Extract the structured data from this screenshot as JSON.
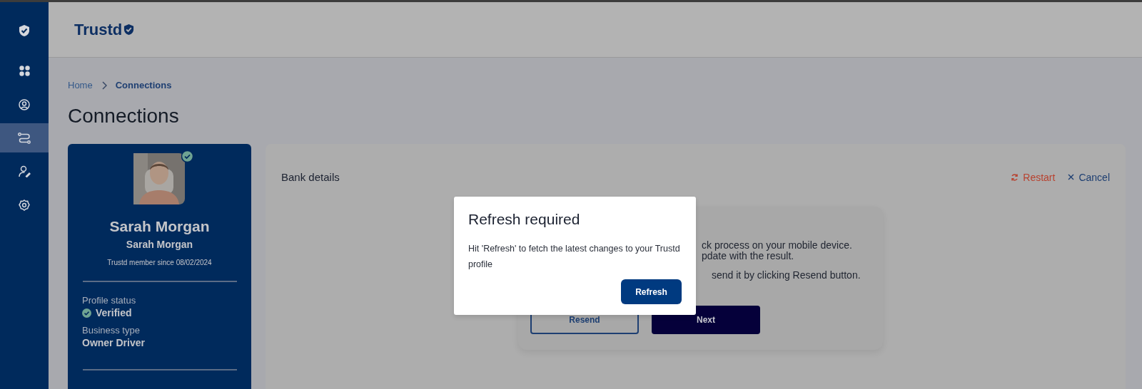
{
  "sidebar": {
    "items": [
      {
        "selected": false
      },
      {
        "selected": false
      },
      {
        "selected": false
      },
      {
        "selected": true
      },
      {
        "selected": false
      },
      {
        "selected": false
      }
    ]
  },
  "header": {
    "logo": "Trustd"
  },
  "breadcrumb": [
    {
      "label": "Home",
      "current": false
    },
    {
      "label": "Connections",
      "current": true
    }
  ],
  "page_title": "Connections",
  "profile": {
    "photo_verified": true,
    "name": "Sarah Morgan",
    "subname": "Sarah Morgan",
    "member_since": "Trustd member since 08/02/2024",
    "fields": [
      {
        "label": "Profile status",
        "value": "Verified",
        "verified": true
      },
      {
        "label": "Business type",
        "value": "Owner Driver",
        "verified": false
      }
    ]
  },
  "panel": {
    "title": "Bank details",
    "actions": [
      {
        "kind": "restart",
        "label": "Restart"
      },
      {
        "kind": "cancel",
        "label": "Cancel"
      }
    ],
    "card": {
      "lines": [
        "ck process on your mobile device.",
        "pdate with the result.",
        "send it by clicking Resend button."
      ],
      "buttons": [
        {
          "kind": "outline",
          "label": "Resend"
        },
        {
          "kind": "solid",
          "label": "Next"
        }
      ]
    }
  },
  "dialog": {
    "title": "Refresh required",
    "message": "Hit 'Refresh' to fetch the latest changes to your Trustd profile",
    "button": "Refresh"
  }
}
